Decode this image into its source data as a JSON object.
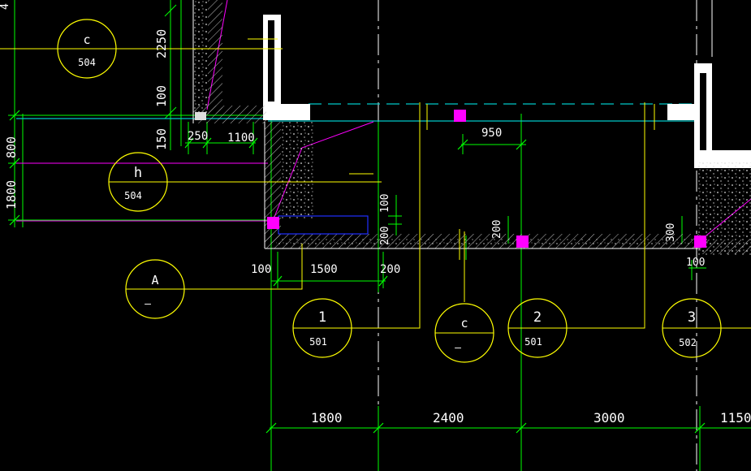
{
  "colors": {
    "background": "#000000",
    "dimension": "#00ff00",
    "annotation": "#ffff00",
    "wall": "#ffffff",
    "hatch": "#cccccc",
    "grid": "#ffffff",
    "centerline": "#00c8c8",
    "pipe": "#ff00ff",
    "opening": "#2030ff",
    "marker": "#ff00ff"
  },
  "top_edge_label": "4",
  "vertical_dims": [
    {
      "id": "v2250",
      "label": "2250"
    },
    {
      "id": "v100a",
      "label": "100"
    },
    {
      "id": "v150",
      "label": "150"
    },
    {
      "id": "v800",
      "label": "800"
    },
    {
      "id": "v1800",
      "label": "1800"
    },
    {
      "id": "v100b",
      "label": "100"
    },
    {
      "id": "v200a",
      "label": "200"
    },
    {
      "id": "v200b",
      "label": "200"
    },
    {
      "id": "v300",
      "label": "300"
    }
  ],
  "horizontal_dims": [
    {
      "id": "h250",
      "label": "250"
    },
    {
      "id": "h1100",
      "label": "1100"
    },
    {
      "id": "h950",
      "label": "950"
    },
    {
      "id": "h100a",
      "label": "100"
    },
    {
      "id": "h1500",
      "label": "1500"
    },
    {
      "id": "h200",
      "label": "200"
    },
    {
      "id": "h100b",
      "label": "100"
    }
  ],
  "bottom_dims": [
    {
      "id": "b1800",
      "label": "1800"
    },
    {
      "id": "b2400",
      "label": "2400"
    },
    {
      "id": "b3000",
      "label": "3000"
    },
    {
      "id": "b1150",
      "label": "1150"
    }
  ],
  "callouts": [
    {
      "id": "c504",
      "top": "c",
      "bottom": "504"
    },
    {
      "id": "h504",
      "top": "h",
      "bottom": "504"
    },
    {
      "id": "A",
      "top": "A",
      "bottom": "—"
    },
    {
      "id": "1-501",
      "top": "1",
      "bottom": "501"
    },
    {
      "id": "c-dash",
      "top": "c",
      "bottom": "—"
    },
    {
      "id": "2-501",
      "top": "2",
      "bottom": "501"
    },
    {
      "id": "3-502",
      "top": "3",
      "bottom": "502"
    }
  ]
}
